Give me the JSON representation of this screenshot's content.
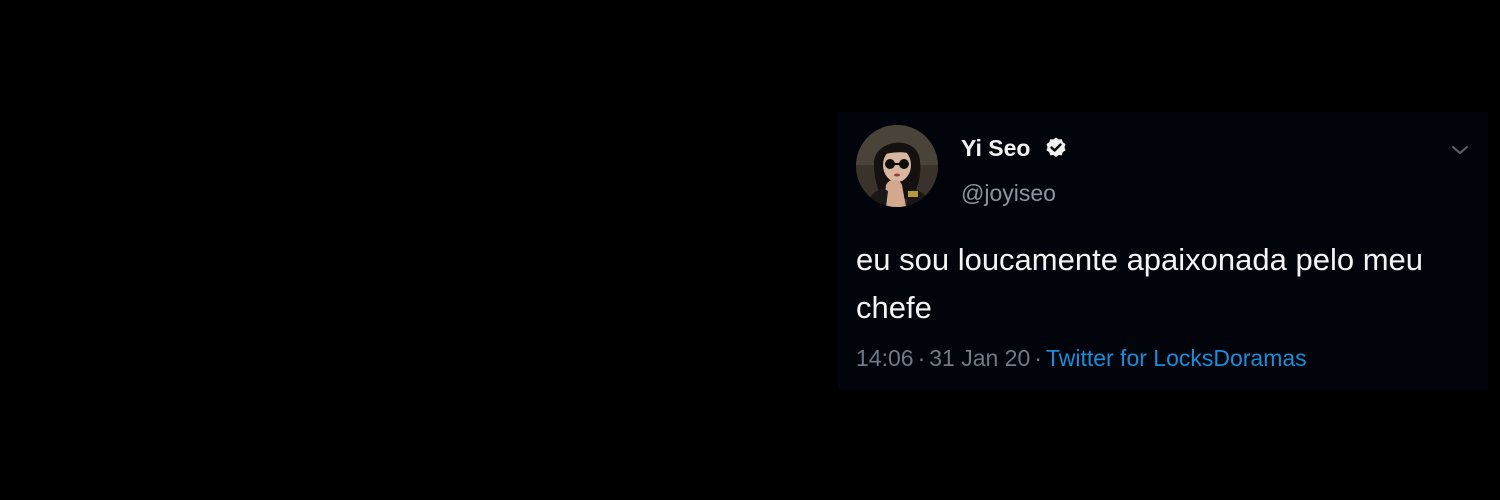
{
  "tweet": {
    "display_name": "Yi Seo",
    "handle": "@joyiseo",
    "text": "eu sou loucamente apaixonada pelo meu chefe",
    "time": "14:06",
    "date": "31 Jan 20",
    "separator": "·",
    "source": "Twitter for LocksDoramas",
    "verified": true,
    "icons": {
      "verified": "verified-badge-icon",
      "more": "chevron-down-icon"
    },
    "colors": {
      "background": "#000000",
      "card": "#02040b",
      "name": "#f2f2f2",
      "handle": "#8b959e",
      "source_link": "#1a8cd8"
    }
  }
}
